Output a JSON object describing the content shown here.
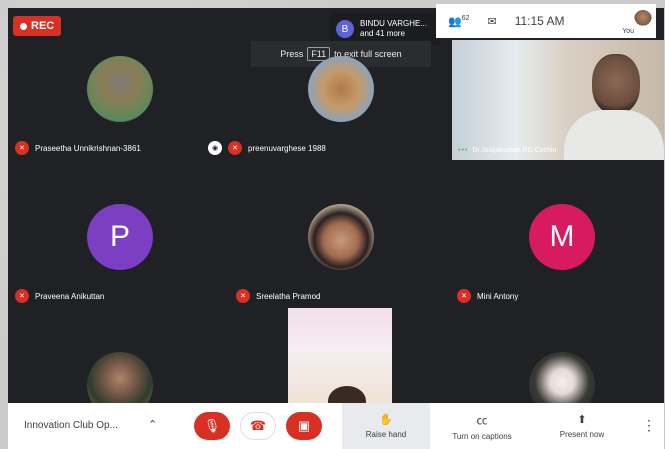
{
  "recording": {
    "label": "REC"
  },
  "joined": {
    "initial": "B",
    "line1": "BINDU VARGHE...",
    "line2": "and 41 more"
  },
  "fullscreen_hint": {
    "prefix": "Press",
    "key": "F11",
    "suffix": "to exit full screen"
  },
  "topbar": {
    "participants_count": "62",
    "time": "11:15 AM",
    "you_label": "You"
  },
  "tiles": [
    {
      "name": "Praseetha Unnikrishnan-3861"
    },
    {
      "name": "preenuvarghese 1988"
    },
    {
      "name": "Dr.Jalajakumari RC Cochin"
    },
    {
      "name": "Praveena Anikuttan",
      "initial": "P",
      "color": "#7b3fc4"
    },
    {
      "name": "Sreelatha Pramod"
    },
    {
      "name": "Mini Antony",
      "initial": "M",
      "color": "#d81b60"
    }
  ],
  "controls": {
    "meeting_name": "Innovation Club Op...",
    "raise_hand": "Raise hand",
    "captions": "Turn on captions",
    "present": "Present now"
  }
}
